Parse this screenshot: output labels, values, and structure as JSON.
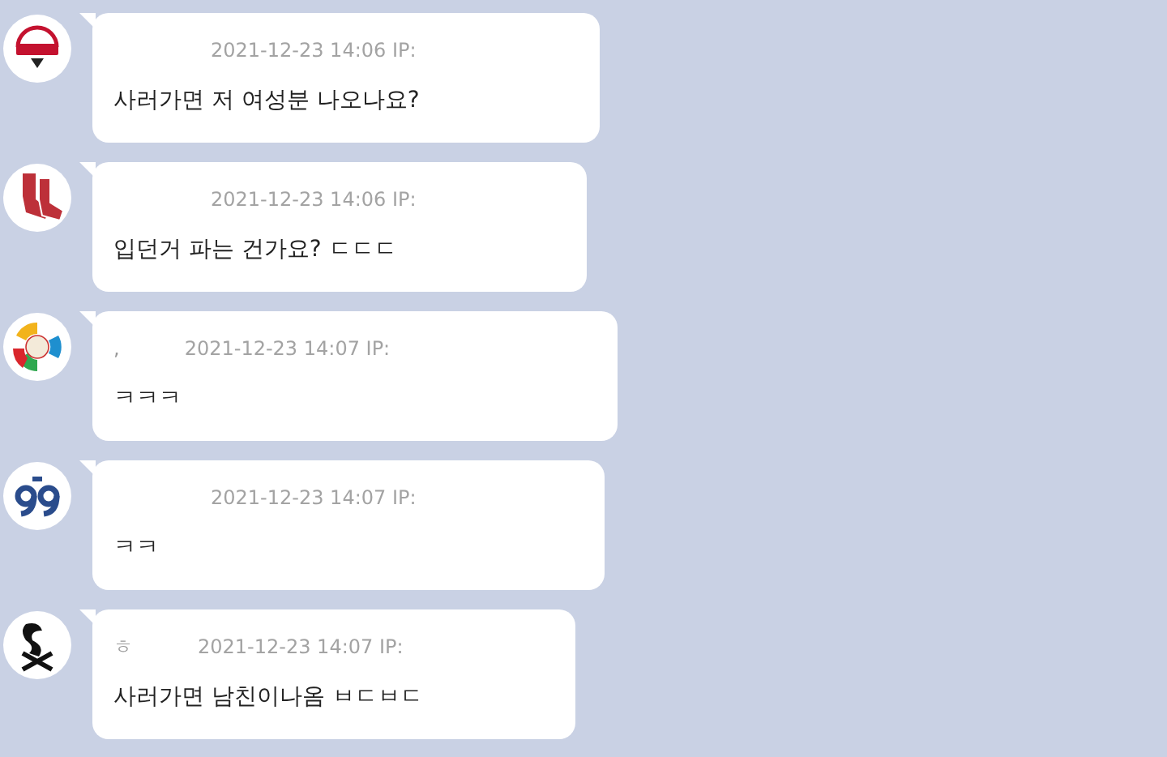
{
  "comments": [
    {
      "kind": "twins",
      "meta": "2021-12-23 14:06 IP:",
      "text": "사러가면 저 여성분 나오나요?"
    },
    {
      "kind": "socks",
      "meta": "2021-12-23 14:06 IP:",
      "text": "입던거 파는 건가요? ㄷㄷㄷ"
    },
    {
      "kind": "ball",
      "prefix": ",",
      "meta": "2021-12-23 14:07 IP:",
      "text": "ㅋㅋㅋ"
    },
    {
      "kind": "jersey",
      "meta": "2021-12-23 14:07 IP:",
      "text": "ㅋㅋ"
    },
    {
      "kind": "sox",
      "prefix": "ㅎ",
      "meta": "2021-12-23 14:07 IP:",
      "text": "사러가면 남친이나옴 ㅂㄷㅂㄷ"
    }
  ]
}
